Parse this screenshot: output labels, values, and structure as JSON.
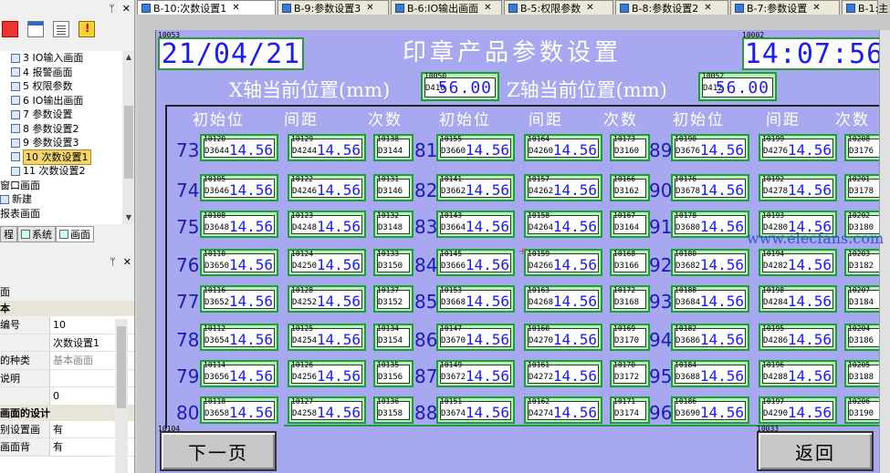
{
  "left_panel": {
    "tree_items": [
      {
        "label": "3 IO输入画面",
        "selected": false
      },
      {
        "label": "4 报警画面",
        "selected": false
      },
      {
        "label": "5 权限参数",
        "selected": false
      },
      {
        "label": "6 IO输出画面",
        "selected": false
      },
      {
        "label": "7 参数设置",
        "selected": false
      },
      {
        "label": "8 参数设置2",
        "selected": false
      },
      {
        "label": "9 参数设置3",
        "selected": false
      },
      {
        "label": "10 次数设置1",
        "selected": true
      },
      {
        "label": "11 次数设置2",
        "selected": false
      },
      {
        "label": "窗口画面",
        "selected": false
      },
      {
        "label": "新建",
        "selected": false
      },
      {
        "label": "报表画面",
        "selected": false
      }
    ],
    "bottom_tabs": [
      "程",
      "系统",
      "画面"
    ],
    "props_section_header": "本",
    "props_rows": [
      {
        "k": "编号",
        "v": "10",
        "gray": false
      },
      {
        "k": "",
        "v": "次数设置1",
        "gray": false
      },
      {
        "k": "的种类",
        "v": "基本画面",
        "gray": true
      },
      {
        "k": "说明",
        "v": "",
        "gray": false
      },
      {
        "k": "",
        "v": "0",
        "gray": false
      }
    ],
    "props_section2": "画面的设计",
    "props_rows2": [
      {
        "k": "别设置画",
        "v": "有"
      },
      {
        "k": "画面背",
        "v": "有"
      }
    ],
    "panel_label": "面"
  },
  "doc_tabs": [
    {
      "label": "B-10:次数设置1",
      "active": true
    },
    {
      "label": "B-9:参数设置3",
      "active": false
    },
    {
      "label": "B-6:IO输出画面",
      "active": false
    },
    {
      "label": "B-5:权限参数",
      "active": false
    },
    {
      "label": "B-8:参数设置2",
      "active": false
    },
    {
      "label": "B-7:参数设置",
      "active": false
    },
    {
      "label": "B-1:主",
      "active": false
    }
  ],
  "screen": {
    "title": "印章产品参数设置",
    "date_id": "10053",
    "date_text": "21/04/21",
    "time_id": "10002",
    "time_text": "14:07:56",
    "x_label": "X轴当前位置(mm)",
    "x_id": "10050",
    "x_reg": "D410",
    "x_val": "56.00",
    "z_label": "Z轴当前位置(mm)",
    "z_id": "10052",
    "z_reg": "D412",
    "z_val": "56.00",
    "col_headers": [
      "初始位",
      "间距",
      "次数",
      "初始位",
      "间距",
      "次数",
      "初始位",
      "间距",
      "次数"
    ],
    "cell_value": "14.56",
    "groups": [
      {
        "rows": [
          {
            "n": "73",
            "a": [
              "10120",
              "D3644"
            ],
            "b": [
              "10129",
              "D4244"
            ],
            "c": [
              "10138",
              "D3144"
            ]
          },
          {
            "n": "74",
            "a": [
              "10105",
              "D3646"
            ],
            "b": [
              "10122",
              "D4246"
            ],
            "c": [
              "10131",
              "D3146"
            ]
          },
          {
            "n": "75",
            "a": [
              "10108",
              "D3648"
            ],
            "b": [
              "10123",
              "D4248"
            ],
            "c": [
              "10132",
              "D3148"
            ]
          },
          {
            "n": "76",
            "a": [
              "10110",
              "D3650"
            ],
            "b": [
              "10124",
              "D4250"
            ],
            "c": [
              "10133",
              "D3150"
            ]
          },
          {
            "n": "77",
            "a": [
              "10116",
              "D3652"
            ],
            "b": [
              "10128",
              "D4252"
            ],
            "c": [
              "10137",
              "D3152"
            ]
          },
          {
            "n": "78",
            "a": [
              "10112",
              "D3654"
            ],
            "b": [
              "10125",
              "D4254"
            ],
            "c": [
              "10134",
              "D3154"
            ]
          },
          {
            "n": "79",
            "a": [
              "10114",
              "D3656"
            ],
            "b": [
              "10126",
              "D4256"
            ],
            "c": [
              "10135",
              "D3156"
            ]
          },
          {
            "n": "80",
            "a": [
              "10118",
              "D3658"
            ],
            "b": [
              "10127",
              "D4258"
            ],
            "c": [
              "10136",
              "D3158"
            ]
          }
        ]
      },
      {
        "rows": [
          {
            "n": "81",
            "a": [
              "10155",
              "D3660"
            ],
            "b": [
              "10164",
              "D4260"
            ],
            "c": [
              "10173",
              "D3160"
            ]
          },
          {
            "n": "82",
            "a": [
              "10141",
              "D3662"
            ],
            "b": [
              "10157",
              "D4262"
            ],
            "c": [
              "10166",
              "D3162"
            ]
          },
          {
            "n": "83",
            "a": [
              "10143",
              "D3664"
            ],
            "b": [
              "10158",
              "D4264"
            ],
            "c": [
              "10167",
              "D3164"
            ]
          },
          {
            "n": "84",
            "a": [
              "10145",
              "D3666"
            ],
            "b": [
              "10159",
              "D4266"
            ],
            "c": [
              "10168",
              "D3166"
            ]
          },
          {
            "n": "85",
            "a": [
              "10153",
              "D3668"
            ],
            "b": [
              "10163",
              "D4268"
            ],
            "c": [
              "10172",
              "D3168"
            ]
          },
          {
            "n": "86",
            "a": [
              "10147",
              "D3670"
            ],
            "b": [
              "10160",
              "D4270"
            ],
            "c": [
              "10169",
              "D3170"
            ]
          },
          {
            "n": "87",
            "a": [
              "10149",
              "D3672"
            ],
            "b": [
              "10161",
              "D4272"
            ],
            "c": [
              "10170",
              "D3172"
            ]
          },
          {
            "n": "88",
            "a": [
              "10151",
              "D3674"
            ],
            "b": [
              "10162",
              "D4274"
            ],
            "c": [
              "10171",
              "D3174"
            ]
          }
        ]
      },
      {
        "rows": [
          {
            "n": "89",
            "a": [
              "10190",
              "D3676"
            ],
            "b": [
              "10199",
              "D4276"
            ],
            "c": [
              "10208",
              "D3176"
            ]
          },
          {
            "n": "90",
            "a": [
              "10176",
              "D3678"
            ],
            "b": [
              "10192",
              "D4278"
            ],
            "c": [
              "10201",
              "D3178"
            ]
          },
          {
            "n": "91",
            "a": [
              "10178",
              "D3680"
            ],
            "b": [
              "10193",
              "D4280"
            ],
            "c": [
              "10202",
              "D3180"
            ]
          },
          {
            "n": "92",
            "a": [
              "10180",
              "D3682"
            ],
            "b": [
              "10194",
              "D4282"
            ],
            "c": [
              "10203",
              "D3182"
            ]
          },
          {
            "n": "93",
            "a": [
              "10188",
              "D3684"
            ],
            "b": [
              "10198",
              "D4284"
            ],
            "c": [
              "10207",
              "D3184"
            ]
          },
          {
            "n": "94",
            "a": [
              "10182",
              "D3686"
            ],
            "b": [
              "10195",
              "D4286"
            ],
            "c": [
              "10204",
              "D3186"
            ]
          },
          {
            "n": "95",
            "a": [
              "10184",
              "D3688"
            ],
            "b": [
              "10196",
              "D4288"
            ],
            "c": [
              "10205",
              "D3188"
            ]
          },
          {
            "n": "96",
            "a": [
              "10186",
              "D3690"
            ],
            "b": [
              "10197",
              "D4290"
            ],
            "c": [
              "10206",
              "D3190"
            ]
          }
        ]
      }
    ],
    "next_btn_id": "10104",
    "next_btn_label": "下一页",
    "back_btn_id": "10033",
    "back_btn_label": "返回",
    "watermark": "www.elecfans.com"
  }
}
